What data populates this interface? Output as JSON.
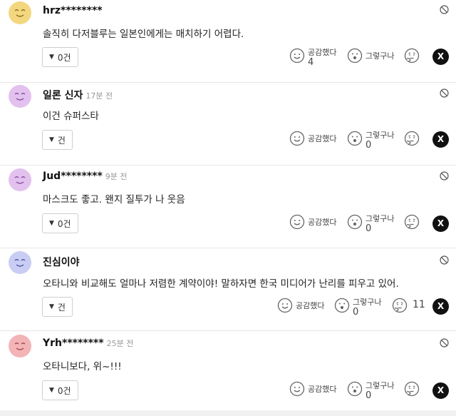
{
  "comments": [
    {
      "author": "hrz********",
      "time": "",
      "text": "솔직히 다저블루는 일본인에게는 매치하기 어렵다.",
      "reply_label": "0건",
      "empathy_label": "공감했다",
      "empathy_count": "4",
      "surprise_label": "그렇구나",
      "surprise_count": "",
      "thinking_count": "",
      "avatar_color": "#f3d77f",
      "avatar_face": "#8a6d1f"
    },
    {
      "author": "일론 신자",
      "time": "17분 전",
      "text": "이건 슈퍼스타",
      "reply_label": "건",
      "empathy_label": "공감했다",
      "empathy_count": "",
      "surprise_label": "그렇구나",
      "surprise_count": "0",
      "thinking_count": "",
      "avatar_color": "#e3c1ef",
      "avatar_face": "#8a4fa0"
    },
    {
      "author": "Jud********",
      "time": "9분 전",
      "text": "마스크도 좋고. 왠지 질투가 나 웃음",
      "reply_label": "0건",
      "empathy_label": "공감했다",
      "empathy_count": "",
      "surprise_label": "그렇구나",
      "surprise_count": "0",
      "thinking_count": "",
      "avatar_color": "#e3c1ef",
      "avatar_face": "#8a4fa0"
    },
    {
      "author": "진심이야",
      "time": "",
      "text": "오타니와 비교해도 얼마나 저렴한 계약이야! 말하자면 한국 미디어가 난리를 피우고 있어.",
      "reply_label": "건",
      "empathy_label": "공감했다",
      "empathy_count": "",
      "surprise_label": "그렇구나",
      "surprise_count": "0",
      "thinking_count": "11",
      "avatar_color": "#c9cdf3",
      "avatar_face": "#4f58a8"
    },
    {
      "author": "Yrh********",
      "time": "25분 전",
      "text": "오타니보다, 위~!!!",
      "reply_label": "0건",
      "empathy_label": "공감했다",
      "empathy_count": "",
      "surprise_label": "그렇구나",
      "surprise_count": "0",
      "thinking_count": "",
      "avatar_color": "#f3b4b7",
      "avatar_face": "#a34a50"
    }
  ],
  "icons": {
    "report": "report-icon",
    "empathy": "smile-icon",
    "surprise": "surprised-face-icon",
    "thinking": "thinking-face-icon",
    "share": "x-share-icon",
    "reply_toggle": "triangle-down-icon"
  },
  "colors": {
    "border": "#e6e6e6",
    "x_button": "#111111",
    "muted": "#999999"
  }
}
